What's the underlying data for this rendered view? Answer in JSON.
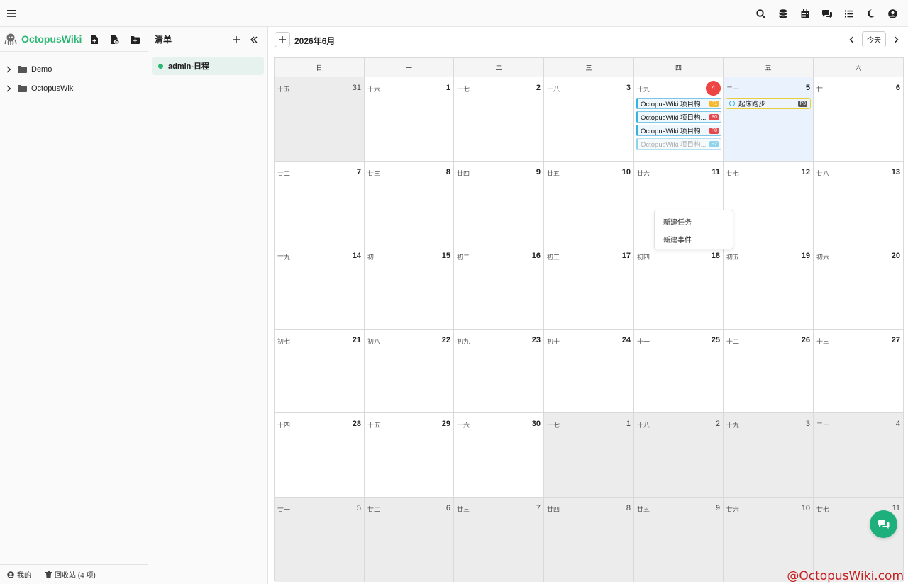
{
  "topbar": {
    "menu_icon": "hamburger-menu-icon",
    "icons": [
      "search-icon",
      "database-icon",
      "calendar-icon",
      "chat-icon",
      "list-icon",
      "dark-mode-icon",
      "user-icon"
    ]
  },
  "sidebar": {
    "brand": "OctopusWiki",
    "actions": [
      "new-file-icon",
      "new-file-settings-icon",
      "new-folder-icon"
    ],
    "tree": [
      {
        "label": "Demo"
      },
      {
        "label": "OctopusWiki"
      }
    ],
    "footer": {
      "mine": "我的",
      "trash": "回收站 (4 项)"
    }
  },
  "listpanel": {
    "title": "清单",
    "items": [
      {
        "label": "admin-日程",
        "color": "#2bb673"
      }
    ]
  },
  "calendar": {
    "title": "2026年6月",
    "today_label": "今天",
    "weekdays": [
      "日",
      "一",
      "二",
      "三",
      "四",
      "五",
      "六"
    ],
    "weeks": [
      [
        {
          "d": "31",
          "l": "十五",
          "o": true
        },
        {
          "d": "1",
          "l": "十六"
        },
        {
          "d": "2",
          "l": "十七"
        },
        {
          "d": "3",
          "l": "十八"
        },
        {
          "d": "4",
          "l": "十九",
          "today": true
        },
        {
          "d": "5",
          "l": "二十"
        },
        {
          "d": "6",
          "l": "廿一"
        }
      ],
      [
        {
          "d": "7",
          "l": "廿二"
        },
        {
          "d": "8",
          "l": "廿三"
        },
        {
          "d": "9",
          "l": "廿四"
        },
        {
          "d": "10",
          "l": "廿五"
        },
        {
          "d": "11",
          "l": "廿六"
        },
        {
          "d": "12",
          "l": "廿七"
        },
        {
          "d": "13",
          "l": "廿八"
        }
      ],
      [
        {
          "d": "14",
          "l": "廿九"
        },
        {
          "d": "15",
          "l": "初一"
        },
        {
          "d": "16",
          "l": "初二"
        },
        {
          "d": "17",
          "l": "初三"
        },
        {
          "d": "18",
          "l": "初四"
        },
        {
          "d": "19",
          "l": "初五"
        },
        {
          "d": "20",
          "l": "初六"
        }
      ],
      [
        {
          "d": "21",
          "l": "初七"
        },
        {
          "d": "22",
          "l": "初八"
        },
        {
          "d": "23",
          "l": "初九"
        },
        {
          "d": "24",
          "l": "初十"
        },
        {
          "d": "25",
          "l": "十一"
        },
        {
          "d": "26",
          "l": "十二"
        },
        {
          "d": "27",
          "l": "十三"
        }
      ],
      [
        {
          "d": "28",
          "l": "十四"
        },
        {
          "d": "29",
          "l": "十五"
        },
        {
          "d": "30",
          "l": "十六"
        },
        {
          "d": "1",
          "l": "十七",
          "o": true
        },
        {
          "d": "2",
          "l": "十八",
          "o": true
        },
        {
          "d": "3",
          "l": "十九",
          "o": true
        },
        {
          "d": "4",
          "l": "二十",
          "o": true
        }
      ],
      [
        {
          "d": "5",
          "l": "廿一",
          "o": true
        },
        {
          "d": "6",
          "l": "廿二",
          "o": true
        },
        {
          "d": "7",
          "l": "廿三",
          "o": true
        },
        {
          "d": "8",
          "l": "廿四",
          "o": true
        },
        {
          "d": "9",
          "l": "廿五",
          "o": true
        },
        {
          "d": "10",
          "l": "廿六",
          "o": true
        },
        {
          "d": "11",
          "l": "廿七",
          "o": true
        }
      ]
    ],
    "events_thu": [
      {
        "title": "OctopusWiki 项目构...",
        "badge": "P1",
        "badge_color": "#f5b82e",
        "done": false
      },
      {
        "title": "OctopusWiki 项目构...",
        "badge": "P0",
        "badge_color": "#e5484d",
        "done": false
      },
      {
        "title": "OctopusWiki 项目构...",
        "badge": "P0",
        "badge_color": "#e5484d",
        "done": false
      },
      {
        "title": "OctopusWiki 项目构...",
        "badge": "P2",
        "badge_color": "#36b2de",
        "done": true
      }
    ],
    "event_fri": {
      "title": "起床跑步",
      "badge": "P3"
    }
  },
  "context_menu": {
    "items": [
      "新建任务",
      "新建事件"
    ]
  },
  "fab_icon": "chat-bubbles-icon",
  "watermark": "@OctopusWiki.com"
}
